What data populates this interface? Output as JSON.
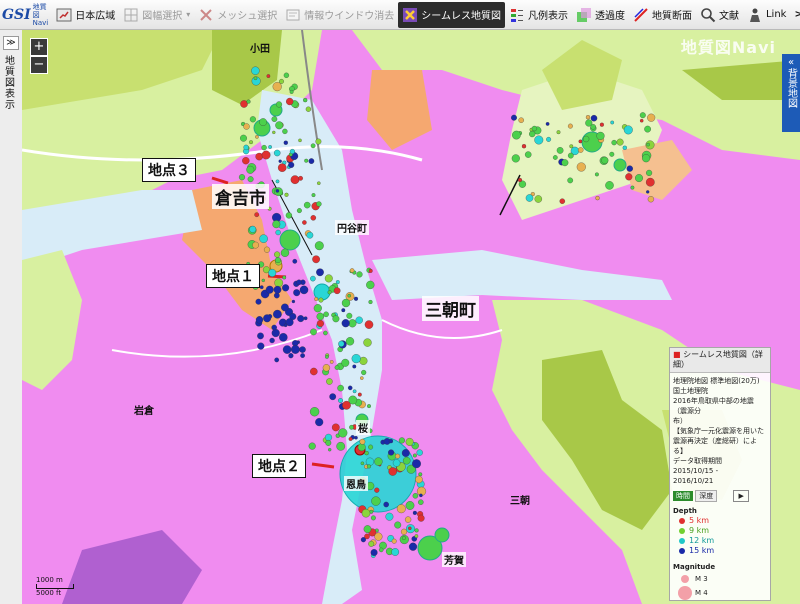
{
  "toolbar": {
    "logo": {
      "text": "GSI",
      "sub1": "地質図",
      "sub2": "Navi"
    },
    "items": [
      {
        "label": "日本広域",
        "state": "normal"
      },
      {
        "label": "図幅選択",
        "state": "disabled"
      },
      {
        "label": "メッシュ選択",
        "state": "disabled"
      },
      {
        "label": "情報ウインドウ消去",
        "state": "disabled"
      },
      {
        "label": "シームレス地質図",
        "state": "active"
      },
      {
        "label": "凡例表示",
        "state": "normal"
      },
      {
        "label": "透過度",
        "state": "normal"
      },
      {
        "label": "地質断面",
        "state": "normal"
      },
      {
        "label": "文献",
        "state": "normal"
      },
      {
        "label": "Link",
        "state": "normal"
      },
      {
        "label": ">>",
        "state": "normal"
      }
    ]
  },
  "leftbar": {
    "pin": "≫",
    "label": "地質図表示"
  },
  "map": {
    "watermark": "地質図Navi",
    "zoom_in": "+",
    "zoom_out": "−",
    "background_panel": "背景地図",
    "callouts": {
      "p1": "地点１",
      "p2": "地点２",
      "p3": "地点３"
    },
    "towns": {
      "kurayoshi": "倉吉市",
      "misasa": "三朝町"
    },
    "places": {
      "oda": "小田",
      "enyacho": "円谷町",
      "iwakura": "岩倉",
      "haga": "芳賀",
      "onbori": "恩鳥",
      "misasa_small": "三朝",
      "kuwa": "桜"
    }
  },
  "legend": {
    "title": "シームレス地質図（詳細）",
    "lines": [
      "地理院地図 標準地図(20万)",
      "国土地理院",
      "2016年鳥取県中部の地震（震源分",
      "布）",
      "【気象庁一元化震源を用いた",
      "震源再決定（産総研）による】",
      "データ取得期間",
      "2015/10/15 -",
      "2016/10/21"
    ],
    "time_btn": "時間",
    "depth_btn": "深度",
    "play_btn": "▶",
    "depth_title": "Depth",
    "depths": [
      {
        "label": "5 km",
        "color": "#e03030"
      },
      {
        "label": "9 km",
        "color": "#70d030"
      },
      {
        "label": "12 km",
        "color": "#20c8c8"
      },
      {
        "label": "15 km",
        "color": "#1a2aa8"
      }
    ],
    "magnitude_title": "Magnitude",
    "magnitudes": [
      "M 3",
      "M 4"
    ]
  },
  "scale": {
    "label1": "1000 m",
    "label2": "5000 ft"
  },
  "colors": {
    "pink": "#f08cf0",
    "lightgreen": "#d8f0a0",
    "yellowgreen": "#c8e070",
    "olive": "#a8c848",
    "orange": "#f5a870",
    "water": "#d8ecf8",
    "accent_blue": "#1d5bb7"
  }
}
